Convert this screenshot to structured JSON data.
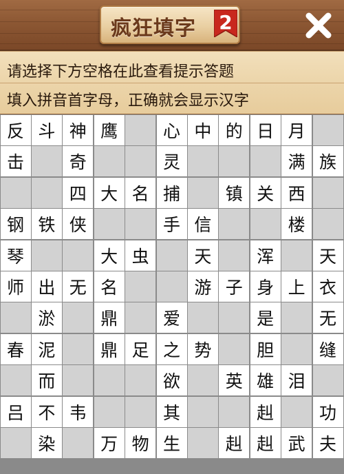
{
  "header": {
    "title": "疯狂填字",
    "level_badge": "2",
    "close_label": "✕"
  },
  "hint": {
    "line1": "请选择下方空格在此查看提示答题",
    "line2": "填入拼音首字母，正确就会显示汉字"
  },
  "colors": {
    "badge_red": "#c8281e",
    "cell_white": "#ffffff",
    "cell_gray": "#d2d2d2"
  },
  "grid": [
    [
      "反",
      "斗",
      "神",
      "鹰",
      "#",
      "心",
      "中",
      "的",
      "日",
      "月",
      "#"
    ],
    [
      "击",
      "#",
      "奇",
      "#",
      "#",
      "灵",
      "#",
      "#",
      "#",
      "满",
      "族"
    ],
    [
      "#",
      "#",
      "四",
      "大",
      "名",
      "捕",
      "#",
      "镇",
      "关",
      "西",
      "#"
    ],
    [
      "钢",
      "铁",
      "侠",
      "#",
      "#",
      "手",
      "信",
      "#",
      "#",
      "楼",
      "#"
    ],
    [
      "琴",
      "#",
      "#",
      "大",
      "虫",
      "#",
      "天",
      "#",
      "浑",
      "#",
      "天"
    ],
    [
      "师",
      "出",
      "无",
      "名",
      "#",
      "#",
      "游",
      "子",
      "身",
      "上",
      "衣"
    ],
    [
      "#",
      "淤",
      "#",
      "鼎",
      "#",
      "爱",
      "#",
      "#",
      "是",
      "#",
      "无"
    ],
    [
      "春",
      "泥",
      "#",
      "鼎",
      "足",
      "之",
      "势",
      "#",
      "胆",
      "#",
      "缝"
    ],
    [
      "#",
      "而",
      "#",
      "#",
      "#",
      "欲",
      "#",
      "英",
      "雄",
      "泪",
      "#"
    ],
    [
      "吕",
      "不",
      "韦",
      "#",
      "#",
      "其",
      "#",
      "#",
      "赳",
      "#",
      "功"
    ],
    [
      "#",
      "染",
      "#",
      "万",
      "物",
      "生",
      "#",
      "赳",
      "赳",
      "武",
      "夫"
    ]
  ]
}
